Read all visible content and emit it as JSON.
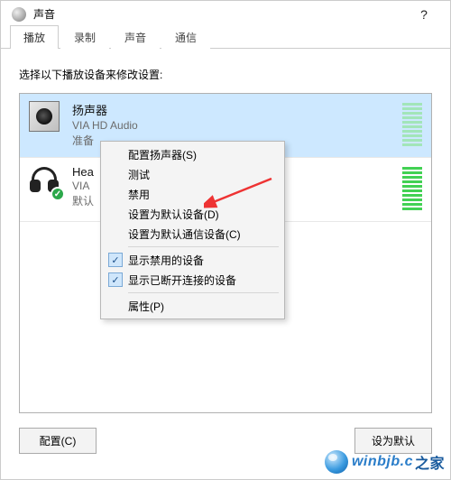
{
  "window": {
    "title": "声音",
    "help_symbol": "?"
  },
  "tabs": {
    "playback": "播放",
    "recording": "录制",
    "sounds": "声音",
    "communications": "通信"
  },
  "instruction": "选择以下播放设备来修改设置:",
  "devices": [
    {
      "name": "扬声器",
      "provider": "VIA HD Audio",
      "status": "准备"
    },
    {
      "name": "Hea",
      "provider": "VIA",
      "status": "默认"
    }
  ],
  "context_menu": {
    "configure": "配置扬声器(S)",
    "test": "测试",
    "disable": "禁用",
    "set_default": "设置为默认设备(D)",
    "set_default_comm": "设置为默认通信设备(C)",
    "show_disabled": "显示禁用的设备",
    "show_disconnected": "显示已断开连接的设备",
    "properties": "属性(P)"
  },
  "footer": {
    "configure": "配置(C)",
    "set_default": "设为默认"
  },
  "status_check_glyph": "✓",
  "watermark": {
    "text": "winbjb.c",
    "cn": "之家"
  }
}
